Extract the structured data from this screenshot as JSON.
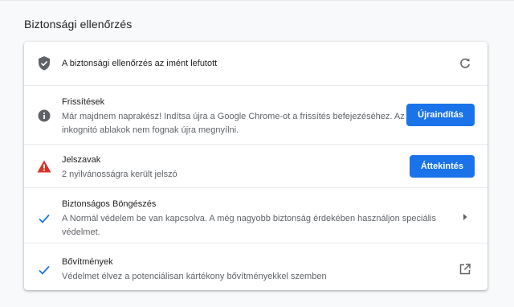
{
  "section": {
    "title": "Biztonsági ellenőrzés"
  },
  "status": {
    "text": "A biztonsági ellenőrzés az imént lefutott"
  },
  "items": [
    {
      "title": "Frissítések",
      "desc1": "Már majdnem naprakész! Indítsa újra a Google Chrome-ot a frissítés befejezéséhez. Az",
      "desc2": "inkognitó ablakok nem fognak újra megnyílni.",
      "button": "Újraindítás",
      "icon": "info-icon"
    },
    {
      "title": "Jelszavak",
      "desc1": "2 nyilvánosságra került jelszó",
      "button": "Áttekintés",
      "icon": "warning-icon"
    },
    {
      "title": "Biztonságos Böngészés",
      "desc1": "A Normál védelem be van kapcsolva. A még nagyobb biztonság érdekében használjon speciális",
      "desc2": "védelmet.",
      "icon": "check-icon",
      "trailing_icon": "arrow-right-icon"
    },
    {
      "title": "Bővítmények",
      "desc1": "Védelmet élvez a potenciálisan kártékony bővítményekkel szemben",
      "icon": "check-icon",
      "trailing_icon": "open-in-new-icon"
    }
  ],
  "colors": {
    "accent": "#1a73e8",
    "warning": "#d93025",
    "icon_grey": "#5f6368"
  }
}
